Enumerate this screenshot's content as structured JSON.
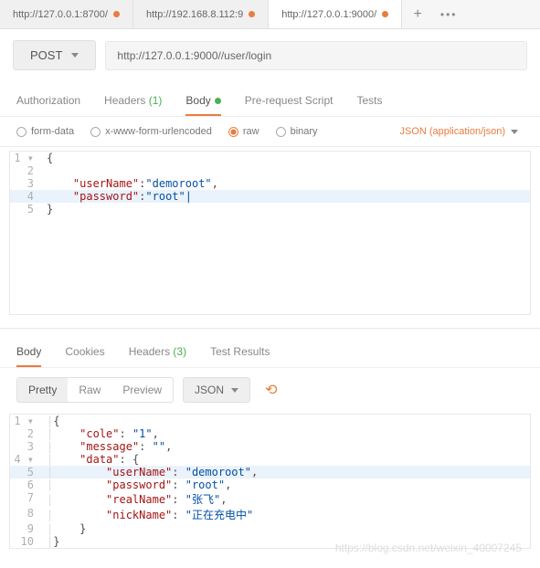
{
  "tabs": [
    {
      "label": "http://127.0.0.1:8700/",
      "active": false
    },
    {
      "label": "http://192.168.8.112:9",
      "active": false
    },
    {
      "label": "http://127.0.0.1:9000/",
      "active": true
    }
  ],
  "method": "POST",
  "url": "http://127.0.0.1:9000//user/login",
  "req_tabs": {
    "authorization": "Authorization",
    "headers": "Headers",
    "headers_count": "(1)",
    "body": "Body",
    "prerequest": "Pre-request Script",
    "tests": "Tests"
  },
  "body_types": {
    "formdata": "form-data",
    "xwww": "x-www-form-urlencoded",
    "raw": "raw",
    "binary": "binary"
  },
  "content_type": "JSON (application/json)",
  "request_body_lines": [
    {
      "n": "1",
      "fold": "▾",
      "text": "{"
    },
    {
      "n": "2",
      "fold": "",
      "text": ""
    },
    {
      "n": "3",
      "fold": "",
      "k": "    \"userName\"",
      "sep": ":",
      "v": "\"demoroot\"",
      "tail": ","
    },
    {
      "n": "4",
      "fold": "",
      "k": "    \"password\"",
      "sep": ":",
      "v": "\"root\"",
      "tail": "",
      "hl": true,
      "cursor": true
    },
    {
      "n": "5",
      "fold": "",
      "text": "}"
    }
  ],
  "resp_tabs": {
    "body": "Body",
    "cookies": "Cookies",
    "headers": "Headers",
    "headers_count": "(3)",
    "tests": "Test Results"
  },
  "resp_view": {
    "pretty": "Pretty",
    "raw": "Raw",
    "preview": "Preview"
  },
  "resp_format": "JSON",
  "chart_data": null,
  "response_body_lines": [
    {
      "n": "1",
      "fold": "▾",
      "text": "{"
    },
    {
      "n": "2",
      "fold": "",
      "indent": "    ",
      "k": "\"cole\"",
      "v": "\"1\"",
      "tail": ","
    },
    {
      "n": "3",
      "fold": "",
      "indent": "    ",
      "k": "\"message\"",
      "v": "\"\"",
      "tail": ","
    },
    {
      "n": "4",
      "fold": "▾",
      "indent": "    ",
      "k": "\"data\"",
      "v_plain": "{",
      "tail": ""
    },
    {
      "n": "5",
      "fold": "",
      "indent": "        ",
      "k": "\"userName\"",
      "v": "\"demoroot\"",
      "tail": ",",
      "hl": true
    },
    {
      "n": "6",
      "fold": "",
      "indent": "        ",
      "k": "\"password\"",
      "v": "\"root\"",
      "tail": ","
    },
    {
      "n": "7",
      "fold": "",
      "indent": "        ",
      "k": "\"realName\"",
      "v": "\"张飞\"",
      "tail": ","
    },
    {
      "n": "8",
      "fold": "",
      "indent": "        ",
      "k": "\"nickName\"",
      "v": "\"正在充电中\"",
      "tail": ""
    },
    {
      "n": "9",
      "fold": "",
      "text": "    }"
    },
    {
      "n": "10",
      "fold": "",
      "text": "}"
    }
  ],
  "watermark": "https://blog.csdn.net/weixin_40007245"
}
